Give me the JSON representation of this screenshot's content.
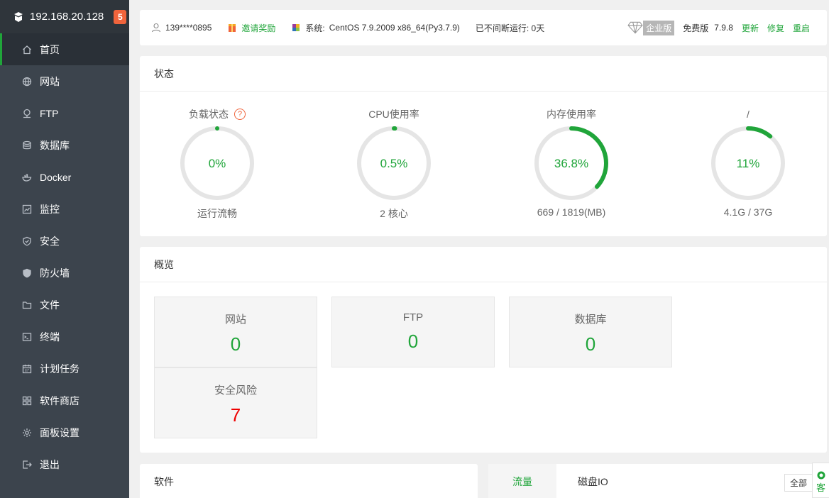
{
  "sidebar": {
    "ip": "192.168.20.128",
    "badge": "5",
    "items": [
      {
        "label": "首页",
        "icon": "home-icon"
      },
      {
        "label": "网站",
        "icon": "globe-icon"
      },
      {
        "label": "FTP",
        "icon": "ftp-icon"
      },
      {
        "label": "数据库",
        "icon": "database-icon"
      },
      {
        "label": "Docker",
        "icon": "docker-icon"
      },
      {
        "label": "监控",
        "icon": "monitor-icon"
      },
      {
        "label": "安全",
        "icon": "shield-check-icon"
      },
      {
        "label": "防火墙",
        "icon": "firewall-icon"
      },
      {
        "label": "文件",
        "icon": "folder-icon"
      },
      {
        "label": "终端",
        "icon": "terminal-icon"
      },
      {
        "label": "计划任务",
        "icon": "calendar-icon"
      },
      {
        "label": "软件商店",
        "icon": "apps-icon"
      },
      {
        "label": "面板设置",
        "icon": "gear-icon"
      },
      {
        "label": "退出",
        "icon": "logout-icon"
      }
    ]
  },
  "topbar": {
    "user": "139****0895",
    "invite": "邀请奖励",
    "system_label": "系统:",
    "system": "CentOS 7.9.2009 x86_64(Py3.7.9)",
    "uptime": "已不间断运行: 0天",
    "edition_tag": "企业版",
    "edition": "免费版",
    "version": "7.9.8",
    "update": "更新",
    "repair": "修复",
    "restart": "重启"
  },
  "status": {
    "title": "状态",
    "gauges": [
      {
        "label": "负载状态",
        "value": "0%",
        "pct": 0,
        "sub": "运行流畅"
      },
      {
        "label": "CPU使用率",
        "value": "0.5%",
        "pct": 0.5,
        "sub": "2 核心"
      },
      {
        "label": "内存使用率",
        "value": "36.8%",
        "pct": 36.8,
        "sub": "669 / 1819(MB)"
      },
      {
        "label": "/",
        "value": "11%",
        "pct": 11,
        "sub": "4.1G / 37G"
      }
    ],
    "colors": {
      "track": "#e5e5e5",
      "fill": "#20a53a"
    }
  },
  "overview": {
    "title": "概览",
    "cards": [
      {
        "name": "网站",
        "value": "0"
      },
      {
        "name": "FTP",
        "value": "0"
      },
      {
        "name": "数据库",
        "value": "0"
      },
      {
        "name": "安全风险",
        "value": "7"
      }
    ]
  },
  "software": {
    "title": "软件"
  },
  "traffic": {
    "tabs": [
      "流量",
      "磁盘IO"
    ],
    "select": "全部"
  },
  "service": {
    "label": "客"
  }
}
